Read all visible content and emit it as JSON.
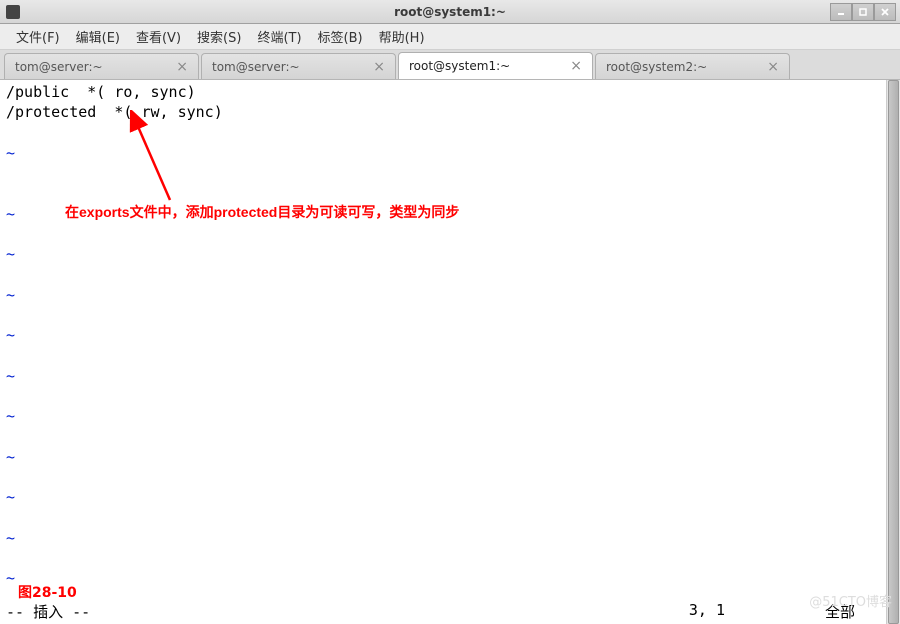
{
  "titlebar": {
    "title": "root@system1:~"
  },
  "menubar": {
    "items": [
      "文件(F)",
      "编辑(E)",
      "查看(V)",
      "搜索(S)",
      "终端(T)",
      "标签(B)",
      "帮助(H)"
    ]
  },
  "tabs": [
    {
      "label": "tom@server:~",
      "active": false
    },
    {
      "label": "tom@server:~",
      "active": false
    },
    {
      "label": "root@system1:~",
      "active": true
    },
    {
      "label": "root@system2:~",
      "active": false
    }
  ],
  "terminal": {
    "lines": [
      "/public  *( ro, sync)",
      "/protected  *( rw, sync)"
    ],
    "tilde": "~"
  },
  "annotation": {
    "text": "在exports文件中，添加protected目录为可读可写，类型为同步"
  },
  "figure_label": "图28-10",
  "status": {
    "mode": "-- 插入 --",
    "position": "3, 1",
    "scroll": "全部"
  },
  "watermark": "@51CTO博客"
}
